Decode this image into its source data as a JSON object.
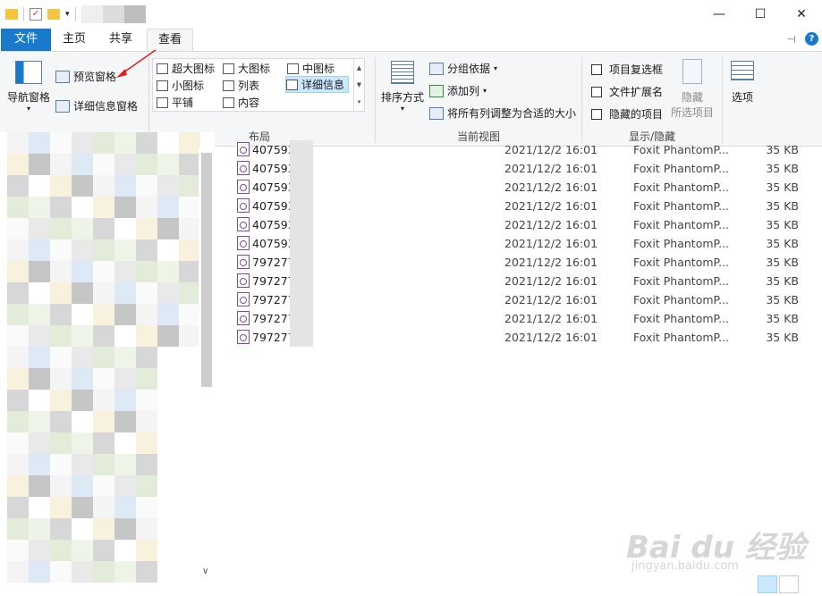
{
  "tabs": {
    "file": "文件",
    "home": "主页",
    "share": "共享",
    "view": "查看"
  },
  "panes": {
    "nav_pane": "导航窗格",
    "preview_pane": "预览窗格",
    "details_pane": "详细信息窗格"
  },
  "layout": {
    "label": "布局",
    "options": [
      "超大图标",
      "大图标",
      "中图标",
      "小图标",
      "列表",
      "详细信息",
      "平铺",
      "内容"
    ],
    "selected": "详细信息"
  },
  "current_view": {
    "label": "当前视图",
    "sort_by": "排序方式",
    "group_by": "分组依据",
    "add_column": "添加列",
    "fit_columns": "将所有列调整为合适的大小"
  },
  "show_hide": {
    "label": "显示/隐藏",
    "item_checkboxes": "项目复选框",
    "file_extensions": "文件扩展名",
    "hidden_items": "隐藏的项目",
    "hide_selected_line1": "隐藏",
    "hide_selected_line2": "所选项目"
  },
  "options": {
    "label": "选项"
  },
  "files": [
    {
      "name": "407593",
      "date": "2021/12/2 16:01",
      "type": "Foxit PhantomP...",
      "size": "35 KB"
    },
    {
      "name": "407593",
      "date": "2021/12/2 16:01",
      "type": "Foxit PhantomP...",
      "size": "35 KB"
    },
    {
      "name": "407593",
      "date": "2021/12/2 16:01",
      "type": "Foxit PhantomP...",
      "size": "35 KB"
    },
    {
      "name": "407593",
      "date": "2021/12/2 16:01",
      "type": "Foxit PhantomP...",
      "size": "35 KB"
    },
    {
      "name": "407593",
      "date": "2021/12/2 16:01",
      "type": "Foxit PhantomP...",
      "size": "35 KB"
    },
    {
      "name": "407593",
      "date": "2021/12/2 16:01",
      "type": "Foxit PhantomP...",
      "size": "35 KB"
    },
    {
      "name": "797277",
      "date": "2021/12/2 16:01",
      "type": "Foxit PhantomP...",
      "size": "35 KB"
    },
    {
      "name": "797277",
      "date": "2021/12/2 16:01",
      "type": "Foxit PhantomP...",
      "size": "35 KB"
    },
    {
      "name": "797277",
      "date": "2021/12/2 16:01",
      "type": "Foxit PhantomP...",
      "size": "35 KB"
    },
    {
      "name": "797277",
      "date": "2021/12/2 16:01",
      "type": "Foxit PhantomP...",
      "size": "35 KB"
    },
    {
      "name": "797277",
      "date": "2021/12/2 16:01",
      "type": "Foxit PhantomP...",
      "size": "35 KB"
    }
  ],
  "watermark": {
    "line1": "Bai du 经验",
    "line2": "jingyan.baidu.com"
  },
  "colors": {
    "accent": "#1979ca",
    "ribbon_bg": "#f5f6f7",
    "selected_bg": "#cce8ff"
  }
}
